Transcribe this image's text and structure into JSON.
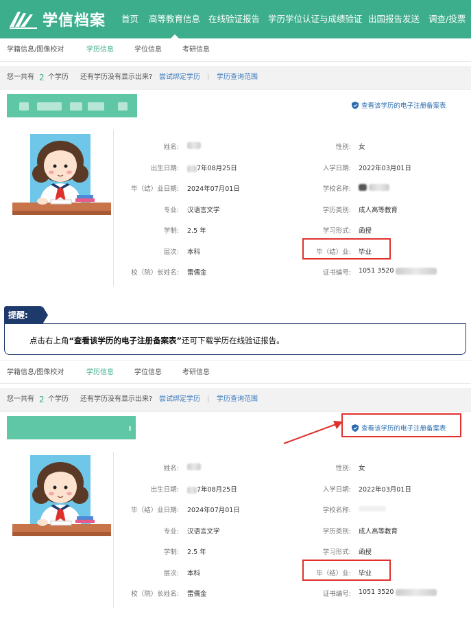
{
  "app": {
    "logo_text": "学信档案",
    "brand_color": "#3dae8c"
  },
  "nav": {
    "items": [
      {
        "label": "首页"
      },
      {
        "label": "高等教育信息",
        "active": true
      },
      {
        "label": "在线验证报告"
      },
      {
        "label": "学历学位认证与成绩验证"
      },
      {
        "label": "出国报告发送"
      },
      {
        "label": "调查/投票"
      }
    ]
  },
  "subtabs": [
    {
      "label": "学籍信息/图像校对"
    },
    {
      "label": "学历信息",
      "active": true
    },
    {
      "label": "学位信息"
    },
    {
      "label": "考研信息"
    }
  ],
  "countbar": {
    "prefix": "您一共有",
    "count": "2",
    "suffix": "个学历",
    "question": "还有学历没有显示出来?",
    "bind_link": "尝试绑定学历",
    "separator": "|",
    "scope_link": "学历查询范围"
  },
  "record": {
    "cert_link": "查看该学历的电子注册备案表",
    "fields_left": [
      {
        "label": "姓名:",
        "value": ""
      },
      {
        "label": "出生日期:",
        "value": "7年08月25日"
      },
      {
        "label": "毕（结）业日期:",
        "value": "2024年07月01日"
      },
      {
        "label": "专业:",
        "value": "汉语言文学"
      },
      {
        "label": "学制:",
        "value": "2.5 年"
      },
      {
        "label": "层次:",
        "value": "本科"
      },
      {
        "label": "校（院）长姓名:",
        "value": "雷儒金"
      }
    ],
    "fields_right": [
      {
        "label": "性别:",
        "value": "女"
      },
      {
        "label": "入学日期:",
        "value": "2022年03月01日"
      },
      {
        "label": "学校名称:",
        "value": ""
      },
      {
        "label": "学历类别:",
        "value": "成人高等教育"
      },
      {
        "label": "学习形式:",
        "value": "函授"
      },
      {
        "label": "毕（结）业:",
        "value": "毕业"
      },
      {
        "label": "证书编号:",
        "value": "1051 3520"
      }
    ]
  },
  "reminder": {
    "tag": "提醒:",
    "text_before": "点击右上角",
    "text_bold": "“查看该学历的电子注册备案表”",
    "text_after": "还可下载学历在线验证报告。"
  },
  "colors": {
    "accent": "#3dae8c",
    "highlight": "#e0302c",
    "reminder": "#1d3a6b",
    "link": "#3b7bbf"
  }
}
